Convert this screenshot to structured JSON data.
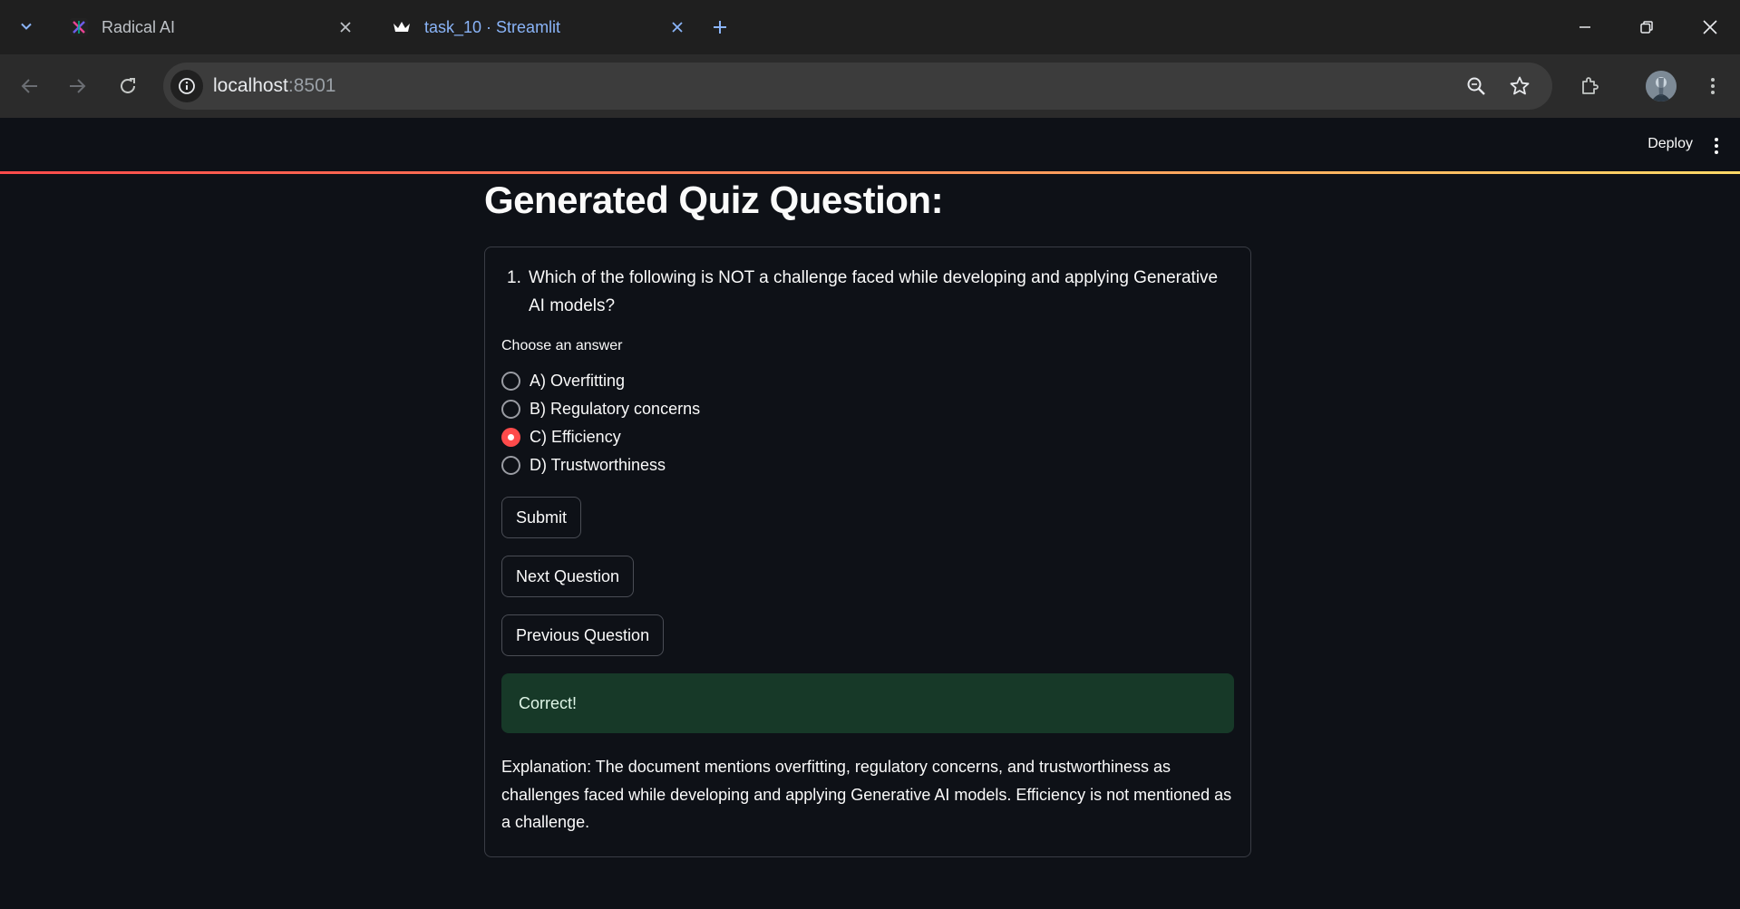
{
  "browser": {
    "tabs": [
      {
        "title": "Radical AI",
        "favicon": "radical-ai-logo-icon",
        "active": false
      },
      {
        "title": "task_10 · Streamlit",
        "favicon": "streamlit-crown-icon",
        "active": true
      }
    ],
    "url_host": "localhost",
    "url_port": ":8501"
  },
  "app": {
    "deploy_label": "Deploy",
    "title": "Generated Quiz Question:",
    "question_number": "1.",
    "question_text": "Which of the following is NOT a challenge faced while developing and applying Generative AI models?",
    "choose_label": "Choose an answer",
    "options": [
      {
        "label": "A) Overfitting",
        "selected": false
      },
      {
        "label": "B) Regulatory concerns",
        "selected": false
      },
      {
        "label": "C) Efficiency",
        "selected": true
      },
      {
        "label": "D) Trustworthiness",
        "selected": false
      }
    ],
    "submit_label": "Submit",
    "next_label": "Next Question",
    "previous_label": "Previous Question",
    "result_text": "Correct!",
    "explanation": "Explanation: The document mentions overfitting, regulatory concerns, and trustworthiness as challenges faced while developing and applying Generative AI models. Efficiency is not mentioned as a challenge."
  },
  "colors": {
    "accent": "#ff4b4b",
    "background": "#0e1117",
    "success_bg": "#173928"
  }
}
